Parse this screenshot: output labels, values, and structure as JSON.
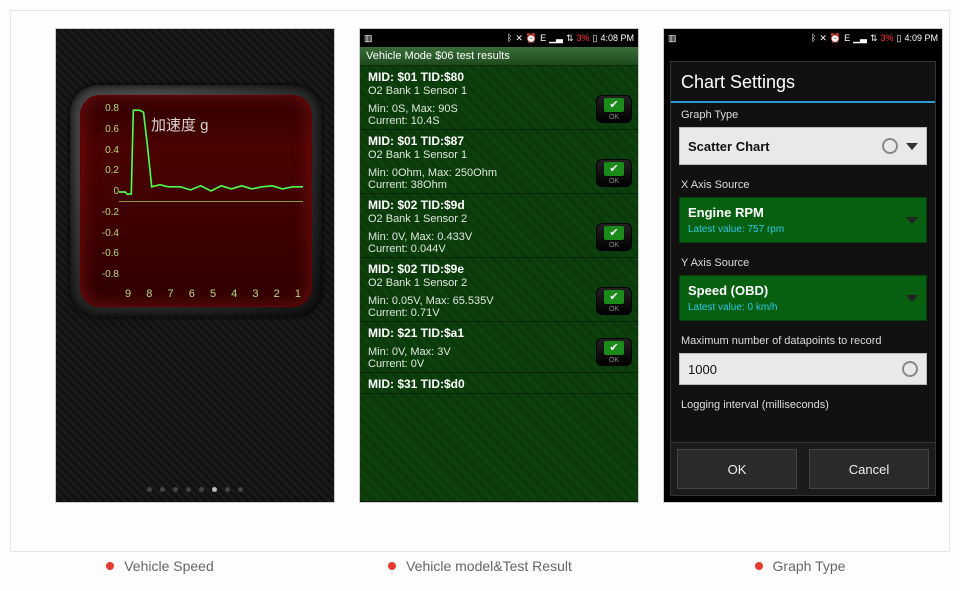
{
  "status": {
    "icons": [
      "bt",
      "mute",
      "alarm",
      "e",
      "sig",
      "wifi",
      "3%"
    ],
    "battery": "3%",
    "time2": "4:08 PM",
    "time3": "4:09 PM"
  },
  "captions": {
    "c1": "Vehicle Speed",
    "c2": "Vehicle model&Test Result",
    "c3": "Graph Type"
  },
  "screen1": {
    "title": "加速度 g",
    "y_ticks": [
      "0.8",
      "0.6",
      "0.4",
      "0.2",
      "0",
      "-0.2",
      "-0.4",
      "-0.6",
      "-0.8"
    ],
    "x_ticks": [
      "9",
      "8",
      "7",
      "6",
      "5",
      "4",
      "3",
      "2",
      "1"
    ],
    "pager_count": 8,
    "pager_active": 5
  },
  "chart_data": {
    "type": "line",
    "title": "加速度 g",
    "xlabel": "",
    "ylabel": "",
    "ylim": [
      -0.9,
      0.9
    ],
    "x": [
      9.6,
      9.5,
      9.4,
      9.2,
      9.0,
      8.9,
      8.8,
      8.6,
      8.4,
      8.2,
      8.0,
      7.5,
      7.0,
      6.5,
      6.0,
      5.5,
      5.0,
      4.5,
      4.0,
      3.5,
      3.0,
      2.5,
      2.0,
      1.5,
      1.0
    ],
    "values": [
      0.0,
      0.0,
      -0.02,
      -0.02,
      0.86,
      0.86,
      0.85,
      0.46,
      0.04,
      0.06,
      0.04,
      0.05,
      0.02,
      0.04,
      0.0,
      0.05,
      0.03,
      0.05,
      0.02,
      0.04,
      0.03,
      0.05,
      0.02,
      0.04,
      0.04
    ],
    "note": "x runs right→left as drawn; values estimated from gridlines"
  },
  "screen2": {
    "title": "Vehicle Mode $06 test results",
    "ok_label": "OK",
    "items": [
      {
        "hd": "MID: $01 TID:$80",
        "sub": "O2 Bank 1 Sensor 1",
        "mm": "Min: 0S, Max: 90S\nCurrent: 10.4S"
      },
      {
        "hd": "MID: $01 TID:$87",
        "sub": "O2 Bank 1 Sensor 1",
        "mm": "Min: 0Ohm, Max: 250Ohm\nCurrent: 38Ohm"
      },
      {
        "hd": "MID: $02 TID:$9d",
        "sub": "O2 Bank 1 Sensor 2",
        "mm": "Min: 0V, Max: 0.433V\nCurrent: 0.044V"
      },
      {
        "hd": "MID: $02 TID:$9e",
        "sub": "O2 Bank 1 Sensor 2",
        "mm": "Min: 0.05V, Max: 65.535V\nCurrent: 0.71V"
      },
      {
        "hd": "MID: $21 TID:$a1",
        "sub": "",
        "mm": "Min: 0V, Max: 3V\nCurrent: 0V"
      },
      {
        "hd": "MID: $31 TID:$d0",
        "sub": "",
        "mm": ""
      }
    ]
  },
  "screen3": {
    "title": "Chart Settings",
    "labels": {
      "graph_type": "Graph Type",
      "x_axis": "X Axis Source",
      "y_axis": "Y Axis Source",
      "max_dp": "Maximum number of datapoints to record",
      "log_int": "Logging interval (milliseconds)"
    },
    "graph_type_value": "Scatter Chart",
    "x_axis": {
      "name": "Engine RPM",
      "lv": "Latest value: 757 rpm"
    },
    "y_axis": {
      "name": "Speed (OBD)",
      "lv": "Latest value: 0 km/h"
    },
    "max_dp_value": "1000",
    "buttons": {
      "ok": "OK",
      "cancel": "Cancel"
    }
  }
}
